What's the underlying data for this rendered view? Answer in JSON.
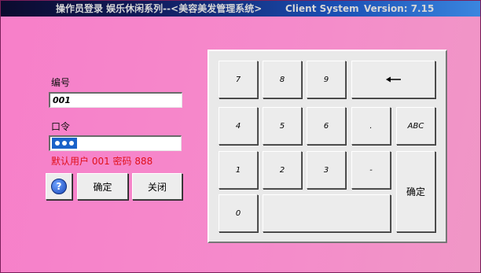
{
  "window": {
    "title": "操作员登录 娱乐休闲系列--<美容美发管理系统>",
    "title_client": "Client System",
    "title_version": "Version: 7.15"
  },
  "form": {
    "id_label": "编号",
    "id_value": "001",
    "password_label": "口令",
    "password_mask_length": 3,
    "hint": "默认用户 001 密码 888"
  },
  "buttons": {
    "help_glyph": "?",
    "ok_label": "确定",
    "close_label": "关闭"
  },
  "keypad": {
    "keys": [
      "7",
      "8",
      "9",
      "4",
      "5",
      "6",
      ".",
      "ABC",
      "1",
      "2",
      "3",
      "-",
      "0",
      ""
    ],
    "backspace_icon": "arrow-left-icon",
    "enter_label": "确定"
  },
  "colors": {
    "window_background": "#f77fc9",
    "title_bar": "#101a5a",
    "hint_text": "#e0101a",
    "selection": "#1a62c9"
  }
}
